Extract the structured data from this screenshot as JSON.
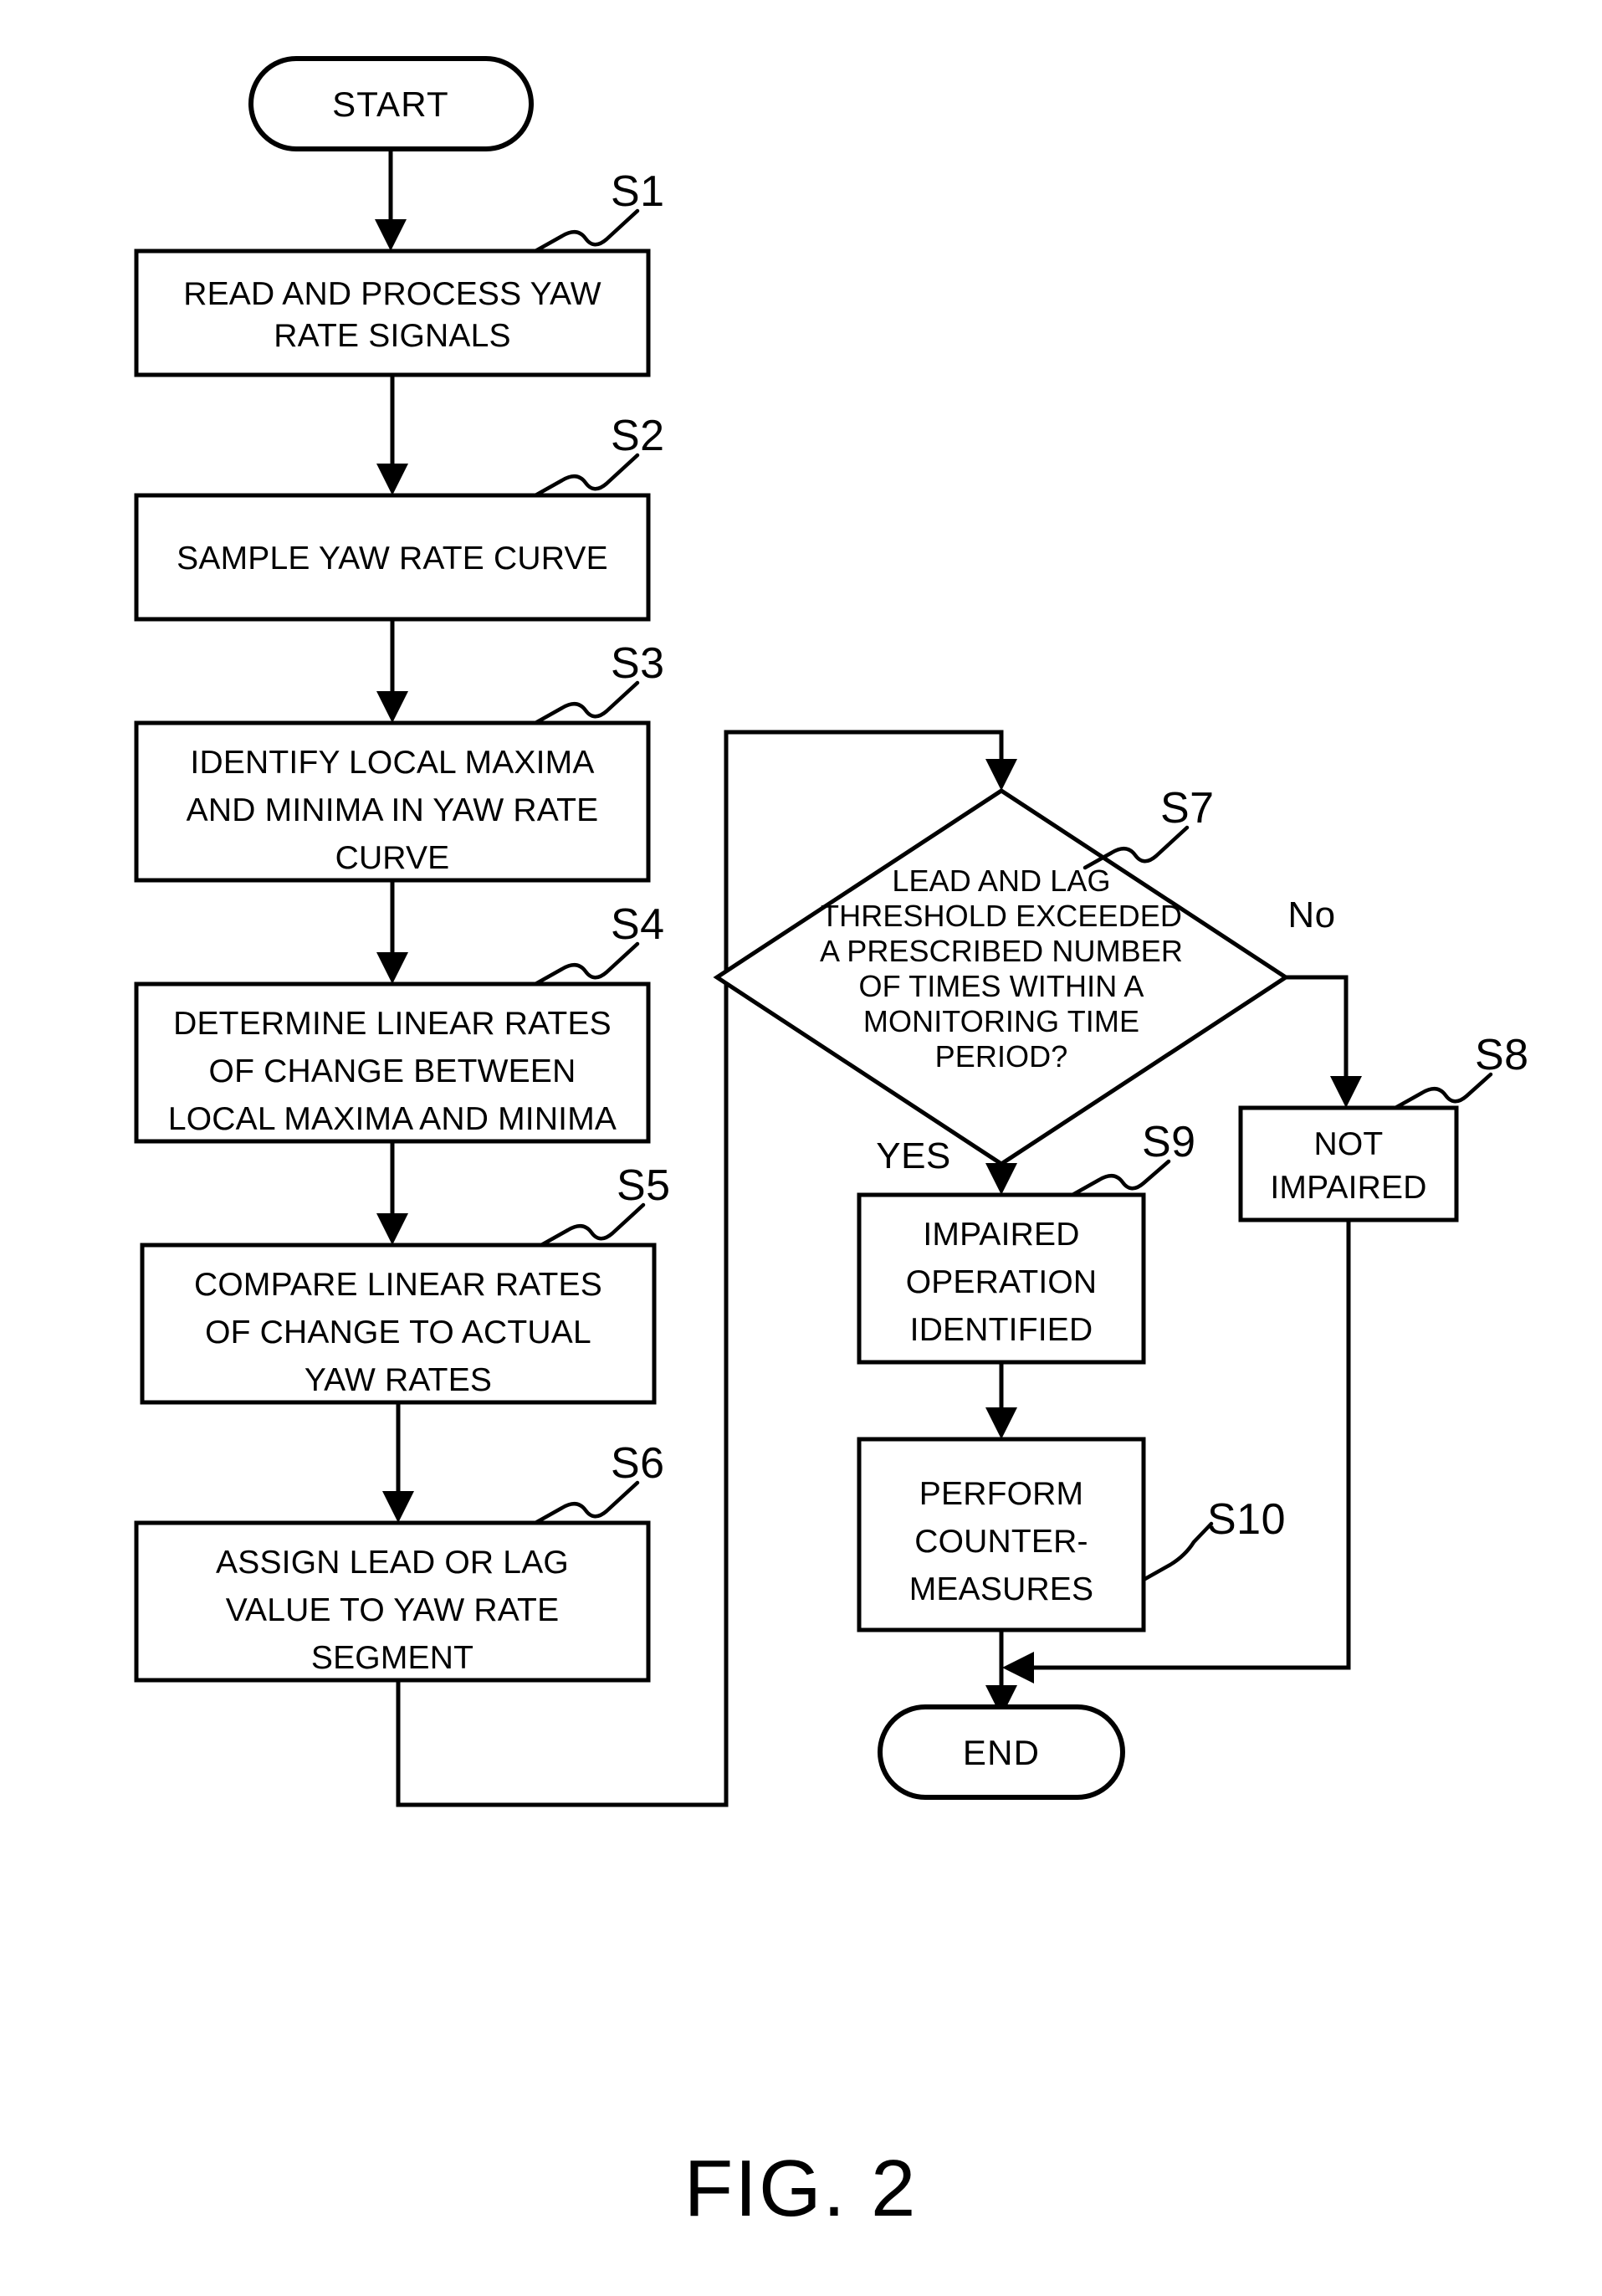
{
  "figure": {
    "caption": "FIG. 2",
    "title": "Yaw rate impairment detection flowchart"
  },
  "terminals": {
    "start": "START",
    "end": "END"
  },
  "steps": [
    {
      "id": "S1",
      "label": "S1",
      "lines": [
        "READ AND PROCESS YAW",
        "RATE SIGNALS"
      ],
      "shape": "process"
    },
    {
      "id": "S2",
      "label": "S2",
      "lines": [
        "SAMPLE YAW RATE CURVE"
      ],
      "shape": "process"
    },
    {
      "id": "S3",
      "label": "S3",
      "lines": [
        "IDENTIFY LOCAL MAXIMA",
        "AND MINIMA IN YAW RATE",
        "CURVE"
      ],
      "shape": "process"
    },
    {
      "id": "S4",
      "label": "S4",
      "lines": [
        "DETERMINE LINEAR RATES",
        "OF CHANGE BETWEEN",
        "LOCAL MAXIMA AND MINIMA"
      ],
      "shape": "process"
    },
    {
      "id": "S5",
      "label": "S5",
      "lines": [
        "COMPARE LINEAR RATES",
        "OF CHANGE TO ACTUAL",
        "YAW RATES"
      ],
      "shape": "process"
    },
    {
      "id": "S6",
      "label": "S6",
      "lines": [
        "ASSIGN LEAD OR LAG",
        "VALUE TO YAW RATE",
        "SEGMENT"
      ],
      "shape": "process"
    },
    {
      "id": "S7",
      "label": "S7",
      "lines": [
        "LEAD AND LAG",
        "THRESHOLD EXCEEDED",
        "A PRESCRIBED NUMBER",
        "OF TIMES WITHIN A",
        "MONITORING TIME",
        "PERIOD?"
      ],
      "shape": "decision"
    },
    {
      "id": "S8",
      "label": "S8",
      "lines": [
        "NOT",
        "IMPAIRED"
      ],
      "shape": "process"
    },
    {
      "id": "S9",
      "label": "S9",
      "lines": [
        "IMPAIRED",
        "OPERATION",
        "IDENTIFIED"
      ],
      "shape": "process"
    },
    {
      "id": "S10",
      "label": "S10",
      "lines": [
        "PERFORM",
        "COUNTER-",
        "MEASURES"
      ],
      "shape": "process"
    }
  ],
  "branches": {
    "yes": "YES",
    "no": "No"
  },
  "colors": {
    "stroke": "#000000",
    "fill": "#ffffff",
    "background": "#ffffff"
  }
}
